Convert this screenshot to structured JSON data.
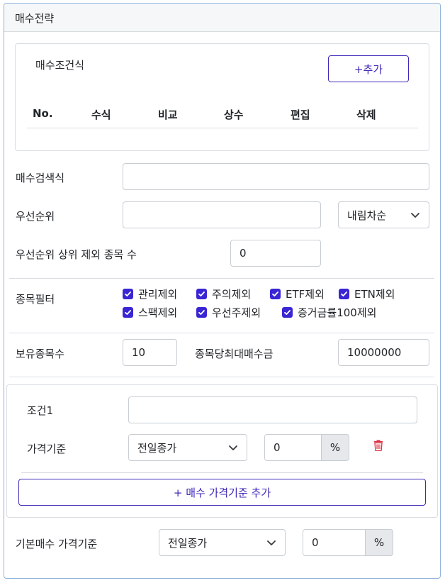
{
  "section": {
    "title": "매수전략"
  },
  "conditions": {
    "title": "매수조건식",
    "add_button": "+추가",
    "columns": [
      "No.",
      "수식",
      "비교",
      "상수",
      "편집",
      "삭제"
    ]
  },
  "search_formula": {
    "label": "매수검색식",
    "value": ""
  },
  "priority": {
    "label": "우선순위",
    "value": "",
    "sort_selected": "내림차순"
  },
  "exclude_top": {
    "label": "우선순위 상위 제외 종목 수",
    "value": "0"
  },
  "filter": {
    "label": "종목필터",
    "options": [
      {
        "label": "관리제외",
        "checked": true
      },
      {
        "label": "주의제외",
        "checked": true
      },
      {
        "label": "ETF제외",
        "checked": true
      },
      {
        "label": "ETN제외",
        "checked": true
      },
      {
        "label": "스팩제외",
        "checked": true
      },
      {
        "label": "우선주제외",
        "checked": true
      },
      {
        "label": "증거금률100제외",
        "checked": true
      }
    ]
  },
  "holdings": {
    "label": "보유종목수",
    "value": "10"
  },
  "max_amount": {
    "label": "종목당최대매수금",
    "value": "10000000"
  },
  "condition1": {
    "label": "조건1",
    "value": "",
    "price_label": "가격기준",
    "price_selected": "전일종가",
    "percent_value": "0",
    "percent_unit": "%",
    "delete_icon": "trash-icon",
    "add_price_button": "+ 매수 가격기준 추가"
  },
  "base_price": {
    "label": "기본매수 가격기준",
    "selected": "전일종가",
    "percent_value": "0",
    "percent_unit": "%"
  },
  "colors": {
    "accent": "#3d2ab8",
    "checkbox": "#3a25d4",
    "danger": "#dc3545",
    "border": "#8fb3dc"
  }
}
